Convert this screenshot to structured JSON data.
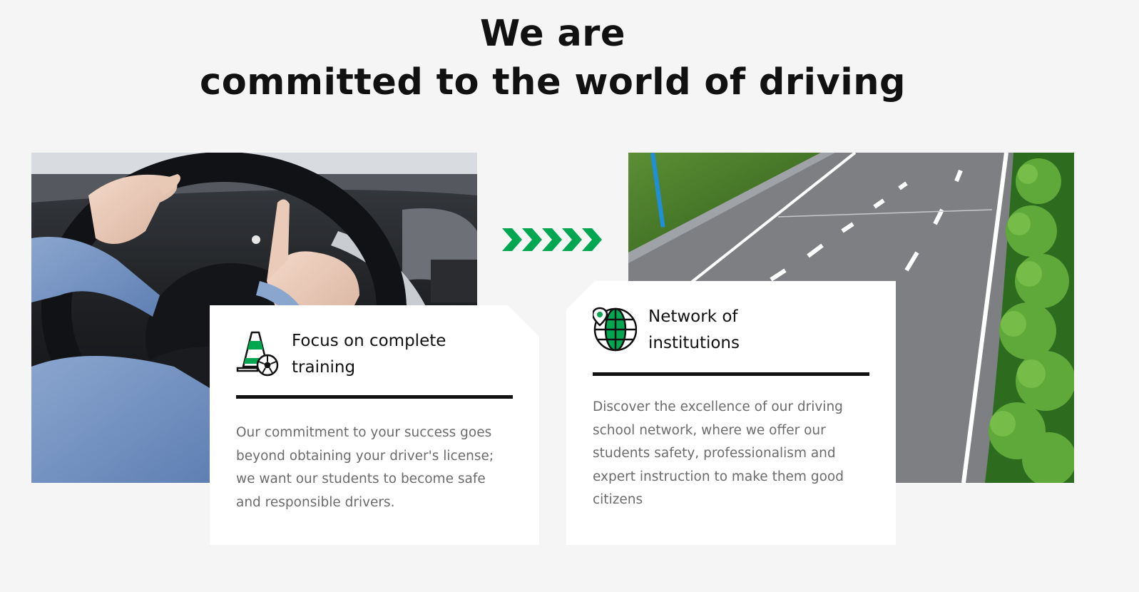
{
  "heading": {
    "line1": "We are",
    "line2": "committed to the world of driving"
  },
  "images": {
    "left": "hands-on-steering-wheel-photo",
    "right": "highway-road-photo"
  },
  "divider": {
    "icon": "chevrons-right-icon",
    "color": "#00a650"
  },
  "cards": [
    {
      "icon": "traffic-cone-ball-icon",
      "title_line1": "Focus on complete",
      "title_line2": "training",
      "text": "Our commitment to your success goes beyond obtaining your driver's license; we want our students to become safe and responsible drivers."
    },
    {
      "icon": "globe-location-icon",
      "title_line1": "Network of",
      "title_line2": "institutions",
      "text": "Discover the excellence of our driving school network, where we offer our students safety, professionalism and expert instruction to make them good citizens"
    }
  ],
  "colors": {
    "accent": "#00a650",
    "text_dark": "#111111",
    "text_muted": "#6b6b6b",
    "background": "#f5f5f5"
  }
}
